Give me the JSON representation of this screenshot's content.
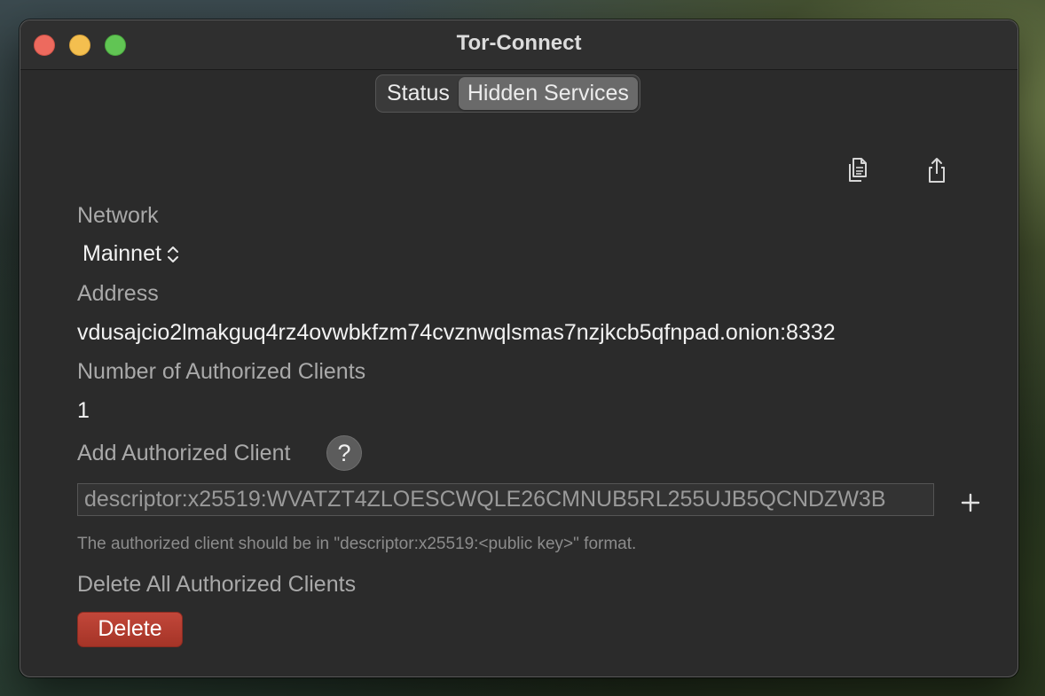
{
  "window": {
    "title": "Tor-Connect"
  },
  "tabs": [
    {
      "label": "Status",
      "selected": false
    },
    {
      "label": "Hidden Services",
      "selected": true
    }
  ],
  "toolbar": {
    "copy_icon": "copy-icon",
    "share_icon": "share-icon"
  },
  "network": {
    "label": "Network",
    "selected": "Mainnet"
  },
  "address": {
    "label": "Address",
    "value": "vdusajcio2lmakguq4rz4ovwbkfzm74cvznwqlsmas7nzjkcb5qfnpad.onion:8332"
  },
  "authorized_clients": {
    "count_label": "Number of Authorized Clients",
    "count": "1"
  },
  "add_client": {
    "label": "Add Authorized Client",
    "help": "?",
    "input_value": "descriptor:x25519:WVATZT4ZLOESCWQLE26CMNUB5RL255UJB5QCNDZW3B",
    "hint": "The authorized client should be in \"descriptor:x25519:<public key>\" format."
  },
  "delete_all": {
    "label": "Delete All Authorized Clients",
    "button": "Delete"
  },
  "colors": {
    "delete_button": "#b23c2f",
    "window_bg": "#2b2b2b"
  }
}
